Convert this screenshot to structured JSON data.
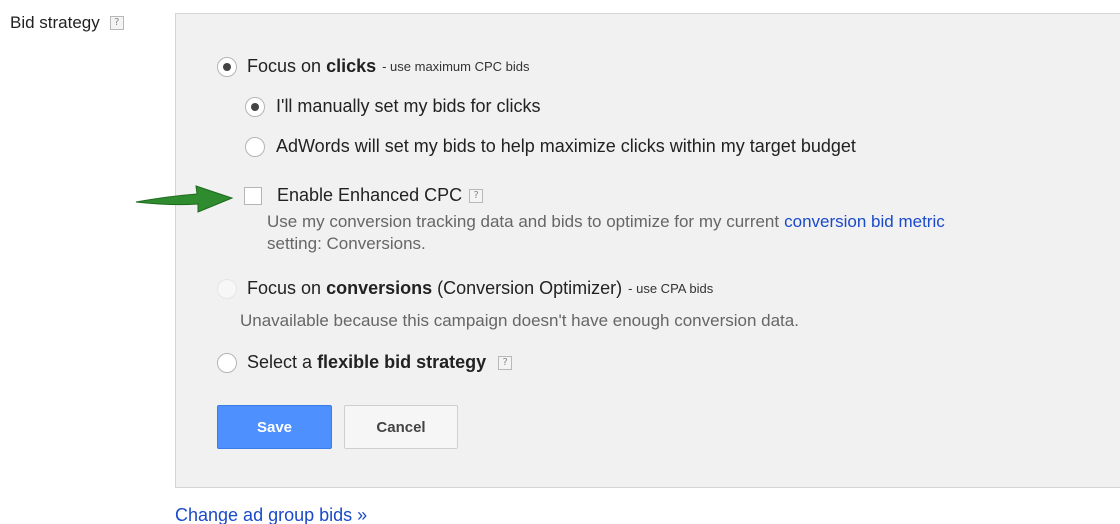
{
  "section": {
    "label": "Bid strategy",
    "help": "?"
  },
  "options": {
    "clicks": {
      "prefix": "Focus on",
      "bold": "clicks",
      "suffix": "- use maximum CPC bids",
      "selected": true
    },
    "manual": {
      "label": "I'll manually set my bids for clicks",
      "selected": true
    },
    "adwords": {
      "label": "AdWords will set my bids to help maximize clicks within my target budget",
      "selected": false
    },
    "ecpc": {
      "label": "Enable Enhanced CPC",
      "help": "?",
      "checked": false,
      "desc_before": "Use my conversion tracking data and bids to optimize for my current",
      "desc_link": "conversion bid metric",
      "desc_line2": "setting: Conversions."
    },
    "conversions": {
      "prefix": "Focus on",
      "bold": "conversions",
      "middle": "(Conversion Optimizer)",
      "suffix": "- use CPA bids",
      "desc": "Unavailable because this campaign doesn't have enough conversion data.",
      "enabled": false
    },
    "flexible": {
      "prefix": "Select a",
      "bold": "flexible bid strategy",
      "help": "?",
      "selected": false
    }
  },
  "buttons": {
    "save": "Save",
    "cancel": "Cancel"
  },
  "footer": {
    "link": "Change ad group bids »"
  },
  "colors": {
    "accent": "#4d90fe",
    "link": "#1a4ac9",
    "arrow": "#2e8b2e"
  }
}
